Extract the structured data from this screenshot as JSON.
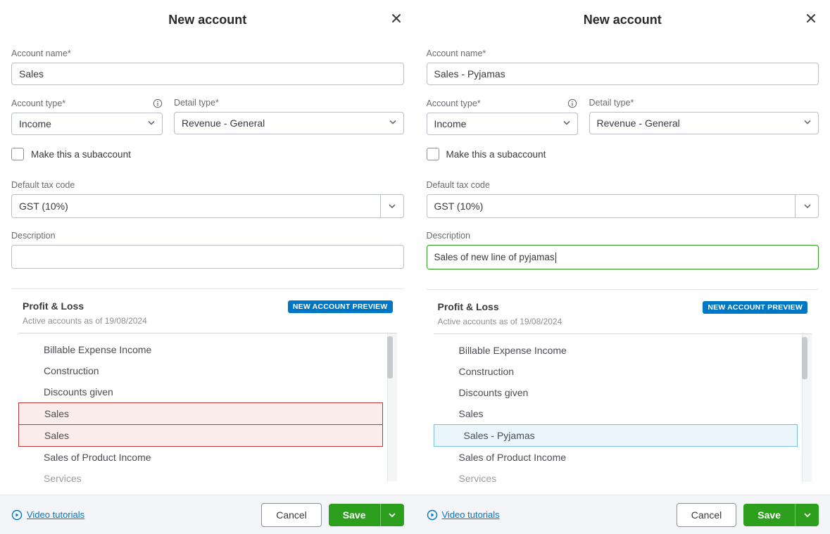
{
  "left": {
    "title": "New account",
    "accountNameLabel": "Account name*",
    "accountNameValue": "Sales",
    "accountTypeLabel": "Account type*",
    "accountTypeValue": "Income",
    "detailTypeLabel": "Detail type*",
    "detailTypeValue": "Revenue - General",
    "subaccountLabel": "Make this a subaccount",
    "taxLabel": "Default tax code",
    "taxValue": "GST (10%)",
    "descLabel": "Description",
    "descValue": "",
    "preview": {
      "title": "Profit & Loss",
      "sub": "Active accounts as of 19/08/2024",
      "badge": "NEW ACCOUNT PREVIEW",
      "items": [
        {
          "label": "Billable Expense Income",
          "cls": ""
        },
        {
          "label": "Construction",
          "cls": ""
        },
        {
          "label": "Discounts given",
          "cls": ""
        },
        {
          "label": "Sales",
          "cls": "highlight-red"
        },
        {
          "label": "Sales",
          "cls": "highlight-red"
        },
        {
          "label": "Sales of Product Income",
          "cls": ""
        },
        {
          "label": "Services",
          "cls": "grey"
        }
      ]
    },
    "footer": {
      "video": "Video tutorials",
      "cancel": "Cancel",
      "save": "Save"
    }
  },
  "right": {
    "title": "New account",
    "accountNameLabel": "Account name*",
    "accountNameValue": "Sales - Pyjamas",
    "accountTypeLabel": "Account type*",
    "accountTypeValue": "Income",
    "detailTypeLabel": "Detail type*",
    "detailTypeValue": "Revenue - General",
    "subaccountLabel": "Make this a subaccount",
    "taxLabel": "Default tax code",
    "taxValue": "GST (10%)",
    "descLabel": "Description",
    "descValue": "Sales of new line of pyjamas",
    "preview": {
      "title": "Profit & Loss",
      "sub": "Active accounts as of 19/08/2024",
      "badge": "NEW ACCOUNT PREVIEW",
      "items": [
        {
          "label": "Billable Expense Income",
          "cls": ""
        },
        {
          "label": "Construction",
          "cls": ""
        },
        {
          "label": "Discounts given",
          "cls": ""
        },
        {
          "label": "Sales",
          "cls": ""
        },
        {
          "label": "Sales - Pyjamas",
          "cls": "highlight-blue"
        },
        {
          "label": "Sales of Product Income",
          "cls": ""
        },
        {
          "label": "Services",
          "cls": "grey"
        }
      ]
    },
    "footer": {
      "video": "Video tutorials",
      "cancel": "Cancel",
      "save": "Save"
    }
  }
}
